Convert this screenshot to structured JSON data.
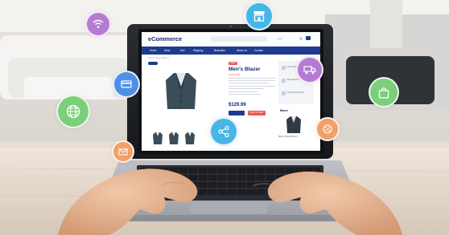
{
  "store": {
    "brand": "eCommerce",
    "top_links": "Login",
    "nav": [
      "Home",
      "Shop",
      "Sell",
      "Shipping",
      "Bestseller",
      "About Us",
      "Contact"
    ],
    "breadcrumb": "Home / Shop / Blazers",
    "badge": "SALE",
    "product_title": "Men's Blazer",
    "rating": "★★★★★",
    "price": "$129.99",
    "add_to_cart": "ADD TO CART",
    "sidebar": [
      "Free Standard Delivery",
      "Easy Returns",
      "Product Protection"
    ],
    "related_heading": "Blazer",
    "related_caption": "Men's Striped Blazer"
  },
  "icons": {
    "wifi": "wifi-icon",
    "store": "store-icon",
    "truck": "truck-icon",
    "bag": "shopping-bag-icon",
    "card": "credit-card-icon",
    "globe": "globe-icon",
    "share": "share-icon",
    "discount": "discount-icon",
    "mail": "mail-icon"
  },
  "colors": {
    "brand_blue": "#1f3b8f",
    "accent_red": "#e85a4a",
    "bubble_purple": "#b57ad1",
    "bubble_cyan": "#47b6e6",
    "bubble_green": "#7ccf7a",
    "bubble_blue": "#4f8fe6",
    "bubble_orange": "#f2a06a"
  }
}
